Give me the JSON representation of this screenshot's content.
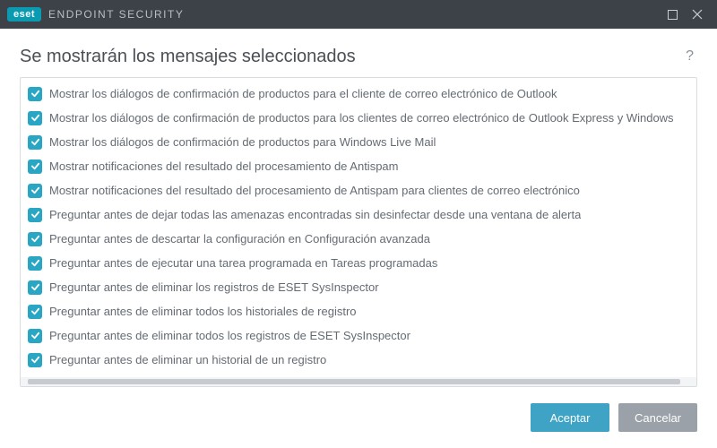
{
  "titlebar": {
    "brand_badge": "eset",
    "brand_text": "ENDPOINT SECURITY"
  },
  "header": {
    "title": "Se mostrarán los mensajes seleccionados",
    "help": "?"
  },
  "list": {
    "items": [
      {
        "checked": true,
        "label": "Mostrar los diálogos de confirmación de productos para el cliente de correo electrónico de Outlook"
      },
      {
        "checked": true,
        "label": "Mostrar los diálogos de confirmación de productos para los clientes de correo electrónico de Outlook Express y Windows"
      },
      {
        "checked": true,
        "label": "Mostrar los diálogos de confirmación de productos para Windows Live Mail"
      },
      {
        "checked": true,
        "label": "Mostrar notificaciones del resultado del procesamiento de Antispam"
      },
      {
        "checked": true,
        "label": "Mostrar notificaciones del resultado del procesamiento de Antispam para clientes de correo electrónico"
      },
      {
        "checked": true,
        "label": "Preguntar antes de dejar todas las amenazas encontradas sin desinfectar desde una ventana de alerta"
      },
      {
        "checked": true,
        "label": "Preguntar antes de descartar la configuración en Configuración avanzada"
      },
      {
        "checked": true,
        "label": "Preguntar antes de ejecutar una tarea programada en Tareas programadas"
      },
      {
        "checked": true,
        "label": "Preguntar antes de eliminar los registros de ESET SysInspector"
      },
      {
        "checked": true,
        "label": "Preguntar antes de eliminar todos los historiales de registro"
      },
      {
        "checked": true,
        "label": "Preguntar antes de eliminar todos los registros de ESET SysInspector"
      },
      {
        "checked": true,
        "label": "Preguntar antes de eliminar un historial de un registro"
      }
    ]
  },
  "footer": {
    "accept": "Aceptar",
    "cancel": "Cancelar"
  }
}
